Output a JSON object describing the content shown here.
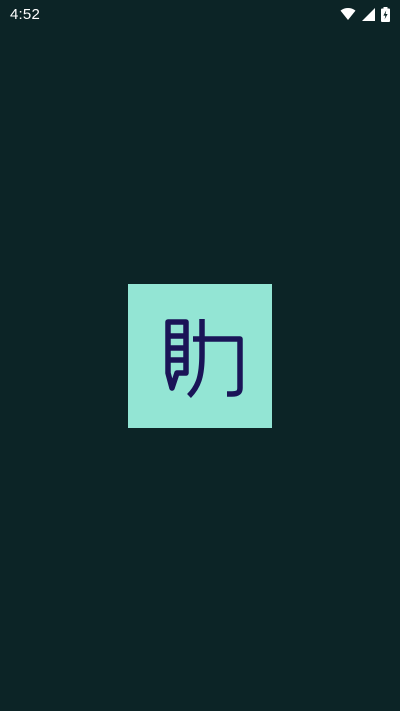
{
  "status_bar": {
    "time": "4:52",
    "icons": [
      "wifi-icon",
      "cellular-signal-icon",
      "battery-charging-icon"
    ]
  },
  "splash": {
    "logo_icon": "app-logo-icon",
    "logo_glyph": "助",
    "colors": {
      "background": "#0c2426",
      "logo_tile": "#93e5d4",
      "logo_ink": "#1a1457",
      "status_text": "#ffffff"
    }
  }
}
